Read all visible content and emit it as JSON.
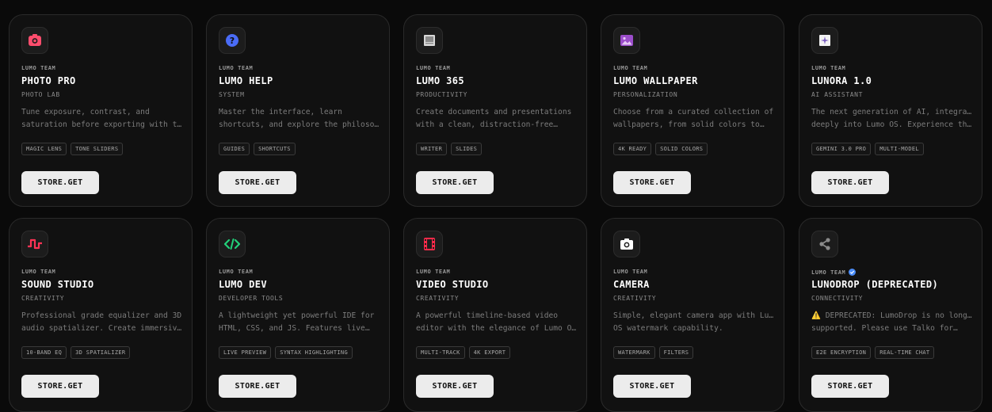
{
  "store_button_label": "STORE.GET",
  "apps": [
    {
      "publisher": "LUMO TEAM",
      "title": "PHOTO PRO",
      "category": "PHOTO LAB",
      "desc_line1": "Tune exposure, contrast, and",
      "desc_line2": "saturation before exporting with the…",
      "tags": [
        "MAGIC LENS",
        "TONE SLIDERS"
      ],
      "icon": "camera-frame-icon",
      "icon_color": "#ff4d6d"
    },
    {
      "publisher": "LUMO TEAM",
      "title": "LUMO HELP",
      "category": "SYSTEM",
      "desc_line1": "Master the interface, learn",
      "desc_line2": "shortcuts, and explore the philosoph…",
      "tags": [
        "GUIDES",
        "SHORTCUTS"
      ],
      "icon": "help-icon",
      "icon_color": "#4a6cf7"
    },
    {
      "publisher": "LUMO TEAM",
      "title": "LUMO 365",
      "category": "PRODUCTIVITY",
      "desc_line1": "Create documents and presentations",
      "desc_line2": "with a clean, distraction-free…",
      "tags": [
        "WRITER",
        "SLIDES"
      ],
      "icon": "document-icon",
      "icon_color": "#9a9a9a"
    },
    {
      "publisher": "LUMO TEAM",
      "title": "LUMO WALLPAPER",
      "category": "PERSONALIZATION",
      "desc_line1": "Choose from a curated collection of",
      "desc_line2": "wallpapers, from solid colors to…",
      "tags": [
        "4K READY",
        "SOLID COLORS"
      ],
      "icon": "image-icon",
      "icon_color": "#9b4dca"
    },
    {
      "publisher": "LUMO TEAM",
      "title": "LUNORA 1.0",
      "category": "AI ASSISTANT",
      "desc_line1": "The next generation of AI, integrated",
      "desc_line2": "deeply into Lumo OS. Experience the…",
      "tags": [
        "GEMINI 3.0 PRO",
        "MULTI-MODEL"
      ],
      "icon": "sparkle-icon",
      "icon_color": "#cfcfcf"
    },
    {
      "publisher": "LUMO TEAM",
      "title": "SOUND STUDIO",
      "category": "CREATIVITY",
      "desc_line1": "Professional grade equalizer and 3D",
      "desc_line2": "audio spatializer. Create immersive…",
      "tags": [
        "10-BAND EQ",
        "3D SPATIALIZER"
      ],
      "icon": "waveform-icon",
      "icon_color": "#ff3355"
    },
    {
      "publisher": "LUMO TEAM",
      "title": "LUMO DEV",
      "category": "DEVELOPER TOOLS",
      "desc_line1": "A lightweight yet powerful IDE for",
      "desc_line2": "HTML, CSS, and JS. Features live…",
      "tags": [
        "LIVE PREVIEW",
        "SYNTAX HIGHLIGHTING"
      ],
      "icon": "code-icon",
      "icon_color": "#22d17a"
    },
    {
      "publisher": "LUMO TEAM",
      "title": "VIDEO STUDIO",
      "category": "CREATIVITY",
      "desc_line1": "A powerful timeline-based video",
      "desc_line2": "editor with the elegance of Lumo OS.",
      "tags": [
        "MULTI-TRACK",
        "4K EXPORT"
      ],
      "icon": "film-icon",
      "icon_color": "#ff2a4a"
    },
    {
      "publisher": "LUMO TEAM",
      "title": "CAMERA",
      "category": "CREATIVITY",
      "desc_line1": "Simple, elegant camera app with Lumo",
      "desc_line2": "OS watermark capability.",
      "tags": [
        "WATERMARK",
        "FILTERS"
      ],
      "icon": "camera-icon",
      "icon_color": "#ffffff"
    },
    {
      "publisher": "LUMO TEAM",
      "verified": true,
      "title": "LUNODROP (DEPRECATED)",
      "category": "CONNECTIVITY",
      "desc_warning": "⚠️",
      "desc_line1": "DEPRECATED: LumoDrop is no longer",
      "desc_line2": "supported. Please use Talko for…",
      "tags": [
        "E2E ENCRYPTION",
        "REAL-TIME CHAT"
      ],
      "icon": "share-icon",
      "icon_color": "#8a8a8a"
    }
  ]
}
